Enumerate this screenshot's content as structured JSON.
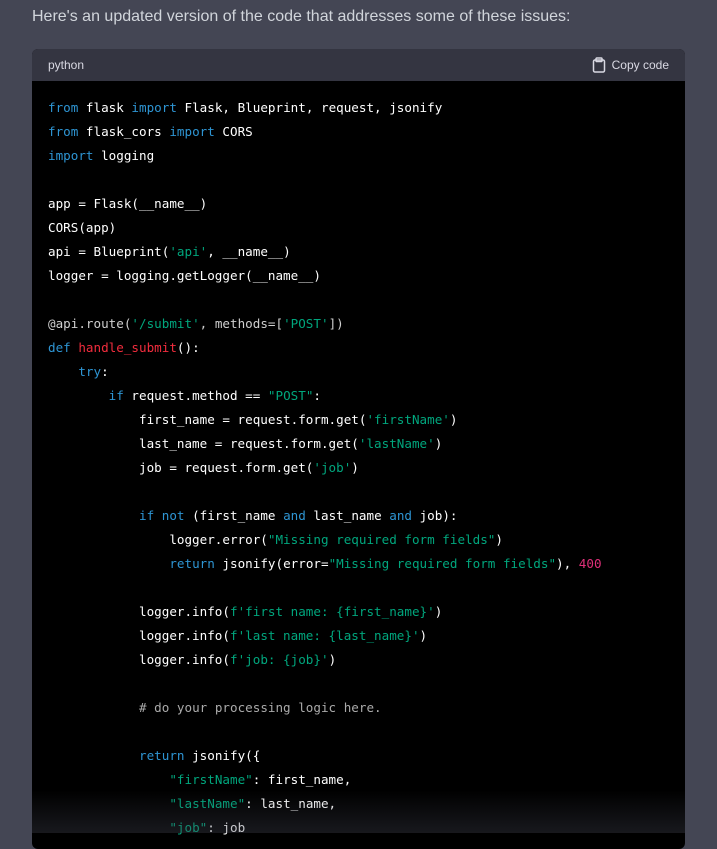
{
  "message": {
    "intro_text": "Here's an updated version of the code that addresses some of these issues:"
  },
  "code_block": {
    "language": "python",
    "copy_label": "Copy code",
    "copy_icon": "clipboard-icon",
    "colors": {
      "keyword": "#2e95d3",
      "function_name": "#f22c3d",
      "string": "#00a67d",
      "number": "#df3079",
      "comment": "#aaaaaa",
      "background": "#000000",
      "header_background": "#343541"
    },
    "lines": [
      [
        {
          "t": "from",
          "c": "kw"
        },
        {
          "t": " flask "
        },
        {
          "t": "import",
          "c": "kw"
        },
        {
          "t": " Flask, Blueprint, request, jsonify"
        }
      ],
      [
        {
          "t": "from",
          "c": "kw"
        },
        {
          "t": " flask_cors "
        },
        {
          "t": "import",
          "c": "kw"
        },
        {
          "t": " CORS"
        }
      ],
      [
        {
          "t": "import",
          "c": "kw"
        },
        {
          "t": " logging"
        }
      ],
      [],
      [
        {
          "t": "app = Flask(__name__)"
        }
      ],
      [
        {
          "t": "CORS(app)"
        }
      ],
      [
        {
          "t": "api = Blueprint("
        },
        {
          "t": "'api'",
          "c": "str"
        },
        {
          "t": ", __name__)"
        }
      ],
      [
        {
          "t": "logger = logging.getLogger(__name__)"
        }
      ],
      [],
      [
        {
          "t": "@api.route(",
          "c": "dec"
        },
        {
          "t": "'/submit'",
          "c": "str"
        },
        {
          "t": ", methods=[",
          "c": "dec"
        },
        {
          "t": "'POST'",
          "c": "str"
        },
        {
          "t": "])",
          "c": "dec"
        }
      ],
      [
        {
          "t": "def",
          "c": "kw"
        },
        {
          "t": " "
        },
        {
          "t": "handle_submit",
          "c": "fn"
        },
        {
          "t": "():"
        }
      ],
      [
        {
          "t": "    "
        },
        {
          "t": "try",
          "c": "kw"
        },
        {
          "t": ":"
        }
      ],
      [
        {
          "t": "        "
        },
        {
          "t": "if",
          "c": "kw"
        },
        {
          "t": " request.method == "
        },
        {
          "t": "\"POST\"",
          "c": "str"
        },
        {
          "t": ":"
        }
      ],
      [
        {
          "t": "            first_name = request.form.get("
        },
        {
          "t": "'firstName'",
          "c": "str"
        },
        {
          "t": ")"
        }
      ],
      [
        {
          "t": "            last_name = request.form.get("
        },
        {
          "t": "'lastName'",
          "c": "str"
        },
        {
          "t": ")"
        }
      ],
      [
        {
          "t": "            job = request.form.get("
        },
        {
          "t": "'job'",
          "c": "str"
        },
        {
          "t": ")"
        }
      ],
      [],
      [
        {
          "t": "            "
        },
        {
          "t": "if",
          "c": "kw"
        },
        {
          "t": " "
        },
        {
          "t": "not",
          "c": "kw"
        },
        {
          "t": " (first_name "
        },
        {
          "t": "and",
          "c": "kw"
        },
        {
          "t": " last_name "
        },
        {
          "t": "and",
          "c": "kw"
        },
        {
          "t": " job):"
        }
      ],
      [
        {
          "t": "                logger.error("
        },
        {
          "t": "\"Missing required form fields\"",
          "c": "str"
        },
        {
          "t": ")"
        }
      ],
      [
        {
          "t": "                "
        },
        {
          "t": "return",
          "c": "kw"
        },
        {
          "t": " jsonify(error="
        },
        {
          "t": "\"Missing required form fields\"",
          "c": "str"
        },
        {
          "t": "), "
        },
        {
          "t": "400",
          "c": "num"
        }
      ],
      [],
      [
        {
          "t": "            logger.info("
        },
        {
          "t": "f'first name: {first_name}'",
          "c": "str"
        },
        {
          "t": ")"
        }
      ],
      [
        {
          "t": "            logger.info("
        },
        {
          "t": "f'last name: {last_name}'",
          "c": "str"
        },
        {
          "t": ")"
        }
      ],
      [
        {
          "t": "            logger.info("
        },
        {
          "t": "f'job: {job}'",
          "c": "str"
        },
        {
          "t": ")"
        }
      ],
      [],
      [
        {
          "t": "            "
        },
        {
          "t": "# do your processing logic here.",
          "c": "cm"
        }
      ],
      [],
      [
        {
          "t": "            "
        },
        {
          "t": "return",
          "c": "kw"
        },
        {
          "t": " jsonify({"
        }
      ],
      [
        {
          "t": "                "
        },
        {
          "t": "\"firstName\"",
          "c": "str"
        },
        {
          "t": ": first_name,"
        }
      ],
      [
        {
          "t": "                "
        },
        {
          "t": "\"lastName\"",
          "c": "str"
        },
        {
          "t": ": last_name,"
        }
      ],
      [
        {
          "t": "                "
        },
        {
          "t": "\"job\"",
          "c": "str"
        },
        {
          "t": ": job"
        }
      ]
    ]
  }
}
